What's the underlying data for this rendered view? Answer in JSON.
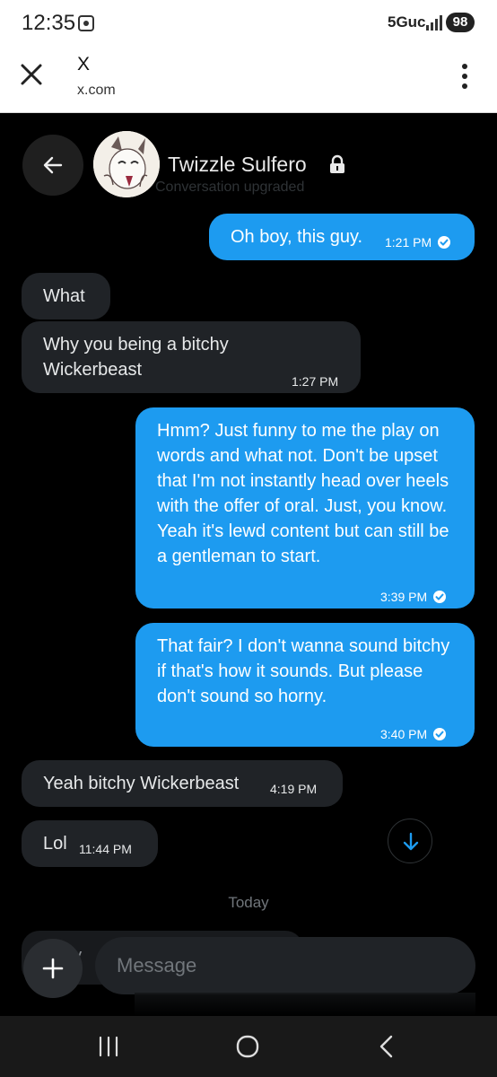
{
  "status_bar": {
    "time": "12:35",
    "network": "5Guc",
    "battery": "98"
  },
  "browser": {
    "title": "X",
    "url": "x.com"
  },
  "chat": {
    "contact_name": "Twizzle Sulfero",
    "status": "Conversation upgraded",
    "messages": [
      {
        "dir": "out",
        "text": "Oh boy, this guy.",
        "time": "1:21 PM"
      },
      {
        "dir": "in",
        "text": "What",
        "time": ""
      },
      {
        "dir": "in",
        "text": "Why you being a bitchy Wickerbeast",
        "time": "1:27 PM"
      },
      {
        "dir": "out",
        "text": "Hmm? Just funny to me the play on words and what not. Don't be upset that I'm not instantly head over heels with the offer of oral. Just, you know. Yeah it's lewd content but can still be a gentleman to start.",
        "time": "3:39 PM"
      },
      {
        "dir": "out",
        "text": "That fair? I don't wanna sound bitchy if that's how it sounds. But please don't sound so horny.",
        "time": "3:40 PM"
      },
      {
        "dir": "in",
        "text": "Yeah bitchy Wickerbeast",
        "time": "4:19 PM"
      },
      {
        "dir": "in",
        "text": "Lol",
        "time": "11:44 PM"
      }
    ],
    "day_divider": "Today",
    "partial_message": "hy"
  },
  "composer": {
    "placeholder": "Message"
  },
  "colors": {
    "accent": "#1d9bf0",
    "incoming": "#202327",
    "background": "#000000"
  },
  "icons": [
    "camera-icon",
    "signal-icon",
    "close-icon",
    "more-vertical-icon",
    "back-arrow-icon",
    "lock-icon",
    "check-circle-icon",
    "arrow-down-icon",
    "plus-icon",
    "recent-apps-icon",
    "home-icon",
    "nav-back-icon"
  ]
}
